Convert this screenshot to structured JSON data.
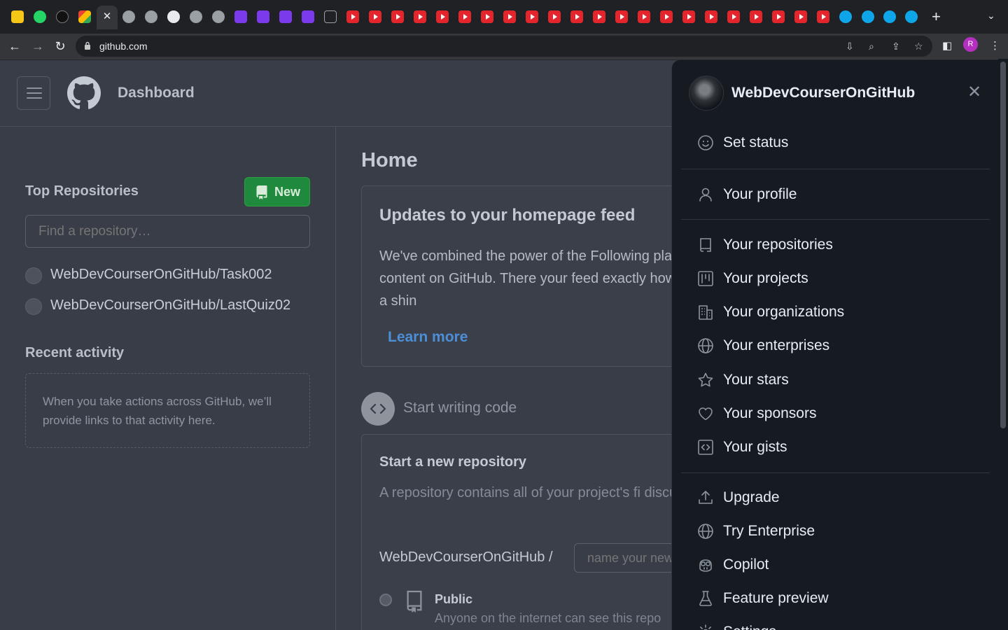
{
  "browser": {
    "url": "github.com",
    "profile_initial": "R"
  },
  "header": {
    "title": "Dashboard"
  },
  "sidebar": {
    "top_repos_title": "Top Repositories",
    "new_button": "New",
    "find_placeholder": "Find a repository…",
    "repos": [
      "WebDevCourserOnGitHub/Task002",
      "WebDevCourserOnGitHub/LastQuiz02"
    ],
    "recent_title": "Recent activity",
    "recent_text": "When you take actions across GitHub, we’ll provide links to that activity here."
  },
  "main": {
    "home_title": "Home",
    "updates_title": "Updates to your homepage feed",
    "updates_text": "We've combined the power of the Following place to discover content on GitHub. There your feed exactly how you like it, and a shin",
    "learn_more": "Learn more",
    "start_code": "Start writing code",
    "new_repo_title": "Start a new repository",
    "new_repo_desc": "A repository contains all of your project's fi discussion.",
    "owner": "WebDevCourserOnGitHub /",
    "name_placeholder": "name your new",
    "public_label": "Public",
    "public_desc": "Anyone on the internet can see this repo"
  },
  "panel": {
    "username": "WebDevCourserOnGitHub",
    "items": [
      {
        "label": "Set status",
        "icon": "smiley-icon"
      },
      {
        "label": "Your profile",
        "icon": "person-icon"
      },
      {
        "label": "Your repositories",
        "icon": "repo-icon"
      },
      {
        "label": "Your projects",
        "icon": "project-icon"
      },
      {
        "label": "Your organizations",
        "icon": "organization-icon"
      },
      {
        "label": "Your enterprises",
        "icon": "globe-icon"
      },
      {
        "label": "Your stars",
        "icon": "star-icon"
      },
      {
        "label": "Your sponsors",
        "icon": "heart-icon"
      },
      {
        "label": "Your gists",
        "icon": "code-square-icon"
      },
      {
        "label": "Upgrade",
        "icon": "upload-icon"
      },
      {
        "label": "Try Enterprise",
        "icon": "globe-icon"
      },
      {
        "label": "Copilot",
        "icon": "copilot-icon"
      },
      {
        "label": "Feature preview",
        "icon": "beaker-icon"
      },
      {
        "label": "Settings",
        "icon": "gear-icon"
      }
    ]
  }
}
